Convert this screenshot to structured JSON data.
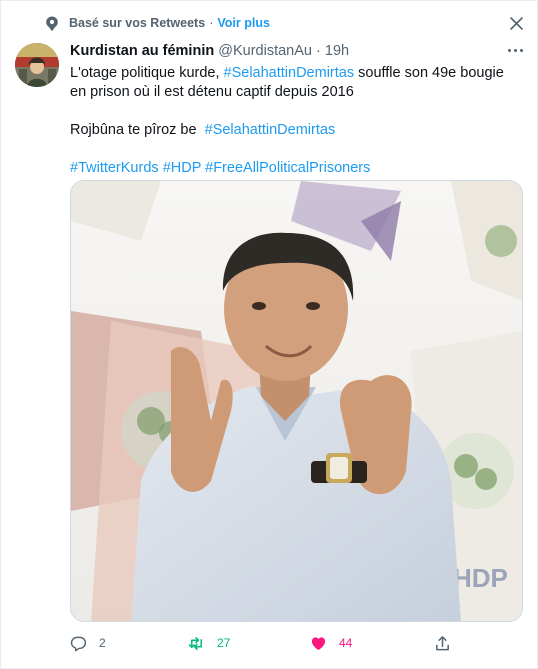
{
  "social_context": {
    "label": "Basé sur vos Retweets",
    "separator": "·",
    "link": "Voir plus"
  },
  "tweet": {
    "author_name": "Kurdistan au féminin",
    "handle": "@KurdistanAu",
    "separator": "·",
    "time": "19h",
    "line1_prefix": "L'otage politique kurde, ",
    "line1_hashtag": "#SelahattinDemirtas",
    "line1_suffix": " souffle son 49e bougie en prison où il est détenu captif depuis 2016",
    "line2_prefix": "Rojbûna te pîroz be  ",
    "line2_hashtag": "#SelahattinDemirtas",
    "hashtags": [
      "#TwitterKurds",
      "#HDP",
      "#FreeAllPoliticalPrisoners"
    ],
    "image_watermark": "HDP"
  },
  "actions": {
    "reply_count": "2",
    "retweet_count": "27",
    "like_count": "44"
  },
  "colors": {
    "accent": "#1d9bf0",
    "retweet": "#00ba7c",
    "like": "#f91880",
    "muted": "#536471"
  }
}
